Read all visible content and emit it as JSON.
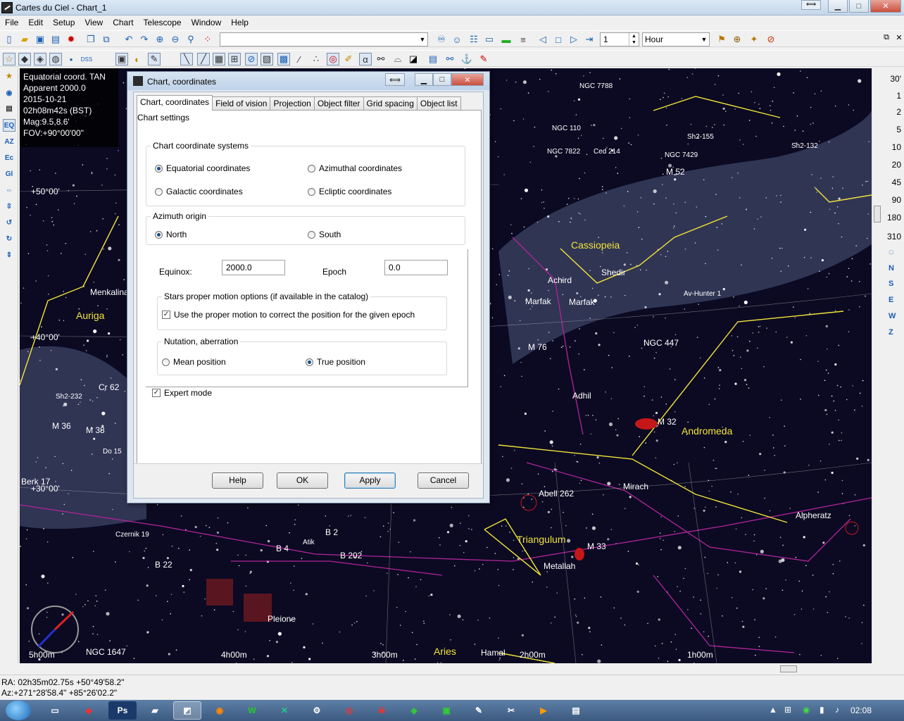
{
  "window": {
    "title": "Cartes du Ciel - Chart_1",
    "ext_button": "⟺",
    "min": "▁",
    "max": "□",
    "close": "✕"
  },
  "menu": [
    "File",
    "Edit",
    "Setup",
    "View",
    "Chart",
    "Telescope",
    "Window",
    "Help"
  ],
  "toolbar": {
    "search_value": "",
    "step_value": "1",
    "time_unit": "Hour"
  },
  "left_tools": [
    "EQ",
    "AZ",
    "Ec",
    "Gl"
  ],
  "fov_values": [
    "30'",
    "1",
    "2",
    "5",
    "10",
    "20",
    "45",
    "90",
    "180",
    "310"
  ],
  "directions": [
    "N",
    "S",
    "E",
    "W",
    "Z"
  ],
  "chart_info": {
    "line1": "Equatorial coord. TAN",
    "line2": "Apparent 2000.0",
    "line3": "2015-10-21",
    "line4": "02h08m42s (BST)",
    "line5": "Mag:9.5,8.6'",
    "line6": "FOV:+90°00'00\""
  },
  "sky_labels": {
    "constellations": [
      "Cassiopeia",
      "Auriga",
      "Andromeda",
      "Triangulum",
      "Aries"
    ],
    "stars": [
      "Menkalinan",
      "Shedir",
      "Achird",
      "Marfak",
      "Marfak",
      "Adhil",
      "Mirach",
      "Alpheratz",
      "Metallah",
      "Pleione",
      "Hamal",
      "Atik",
      "Av-Hunter 1"
    ],
    "objects": [
      "NGC 7788",
      "NGC 110",
      "NGC 7822",
      "Ced 214",
      "NGC 7429",
      "M 52",
      "Sh2-155",
      "Sh2-132",
      "M 76",
      "NGC 447",
      "M 32",
      "Abell 262",
      "M 33",
      "Cr 62",
      "Sh2-232",
      "M 36",
      "M 38",
      "Do 15",
      "Berk 17",
      "Czernik 19",
      "B 4",
      "B 2",
      "B 202",
      "B 22",
      "NGC 1647"
    ],
    "grid": [
      "+50°00'",
      "+40°00'",
      "+30°00'",
      "5h00m",
      "4h00m",
      "3h00m",
      "2h00m",
      "1h00m"
    ]
  },
  "status": {
    "ra": "RA: 02h35m02.75s +50°49'58.2\"",
    "az": "Az:+271°28'58.4\" +85°26'02.2\""
  },
  "taskbar": {
    "clock": "02:08",
    "apps": [
      "Ps",
      "W"
    ]
  },
  "dialog": {
    "title": "Chart, coordinates",
    "tabs": [
      "Chart, coordinates",
      "Field of vision",
      "Projection",
      "Object filter",
      "Grid spacing",
      "Object list"
    ],
    "page_heading": "Chart settings",
    "coord_group": {
      "title": "Chart coordinate systems",
      "equatorial": "Equatorial coordinates",
      "azimuthal": "Azimuthal coordinates",
      "galactic": "Galactic coordinates",
      "ecliptic": "Ecliptic coordinates",
      "selected": "Equatorial coordinates"
    },
    "azimuth_group": {
      "title": "Azimuth origin",
      "north": "North",
      "south": "South",
      "selected": "North"
    },
    "equinox_label": "Equinox:",
    "equinox_value": "2000.0",
    "epoch_label": "Epoch",
    "epoch_value": "0.0",
    "proper_motion_group": {
      "title": "Stars proper motion options (if available in the catalog)",
      "checkbox": "Use the proper motion to correct the position for the given epoch",
      "checked": true
    },
    "nutation_group": {
      "title": "Nutation, aberration",
      "mean": "Mean position",
      "true": "True position",
      "selected": "True position"
    },
    "expert_mode": "Expert mode",
    "expert_checked": true,
    "buttons": {
      "help": "Help",
      "ok": "OK",
      "apply": "Apply",
      "cancel": "Cancel"
    }
  },
  "colors": {
    "sky": "#0b0a22",
    "constellation_line": "#f3e33a",
    "boundary": "#b2249a",
    "milky_way": "#3d4466"
  }
}
